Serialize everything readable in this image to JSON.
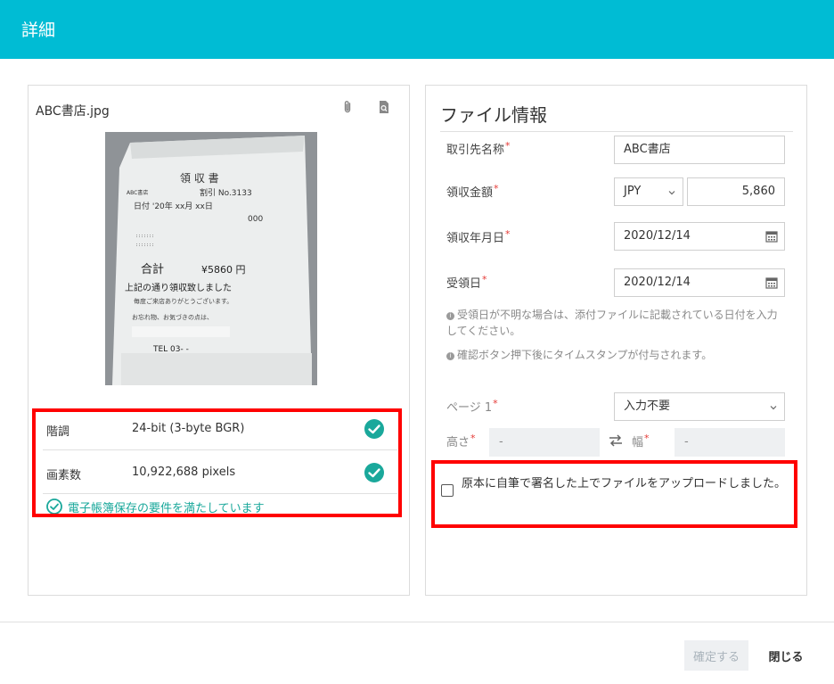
{
  "header": {
    "title": "詳細"
  },
  "preview": {
    "filename": "ABC書店.jpg",
    "receipt": {
      "heading": "領 収 書",
      "store": "ABC書店",
      "ticket": "割引 No.3133",
      "date": "日付 '20年 xx月 xx日",
      "code": "000",
      "total_label": "合計",
      "total_value": "¥5860 円",
      "message": "上記の通り領収致しました",
      "thanks": "毎度ご来店ありがとうございます。",
      "note": "お忘れ物、お気づきの点は、",
      "tel": "TEL 03-    -"
    },
    "rows": [
      {
        "label": "階調",
        "value": "24-bit (3-byte BGR)"
      },
      {
        "label": "画素数",
        "value": "10,922,688 pixels"
      }
    ],
    "compliance": "電子帳簿保存の要件を満たしています"
  },
  "info": {
    "title": "ファイル情報",
    "required_mark": "*",
    "partner": {
      "label": "取引先名称",
      "value": "ABC書店"
    },
    "amount": {
      "label": "領収金額",
      "currency": "JPY",
      "value": "5,860"
    },
    "receipt_date": {
      "label": "領収年月日",
      "value": "2020/12/14"
    },
    "received_date": {
      "label": "受領日",
      "value": "2020/12/14"
    },
    "note1": "受領日が不明な場合は、添付ファイルに記載されている日付を入力してください。",
    "note2": "確認ボタン押下後にタイムスタンプが付与されます。",
    "page": {
      "label": "ページ 1",
      "value": "入力不要"
    },
    "height": {
      "label": "高さ",
      "value": "-"
    },
    "width": {
      "label": "幅",
      "value": "-"
    },
    "checkbox_label": "原本に自筆で署名した上でファイルをアップロードしました。"
  },
  "footer": {
    "confirm": "確定する",
    "close": "閉じる"
  },
  "colors": {
    "header": "#00bcd4",
    "check": "#1aa89b",
    "highlight": "#ff0000"
  },
  "icons": [
    "paperclip-icon",
    "zoom-icon",
    "check-circle-icon",
    "calendar-icon",
    "chevron-down-icon",
    "swap-icon",
    "info-icon"
  ]
}
